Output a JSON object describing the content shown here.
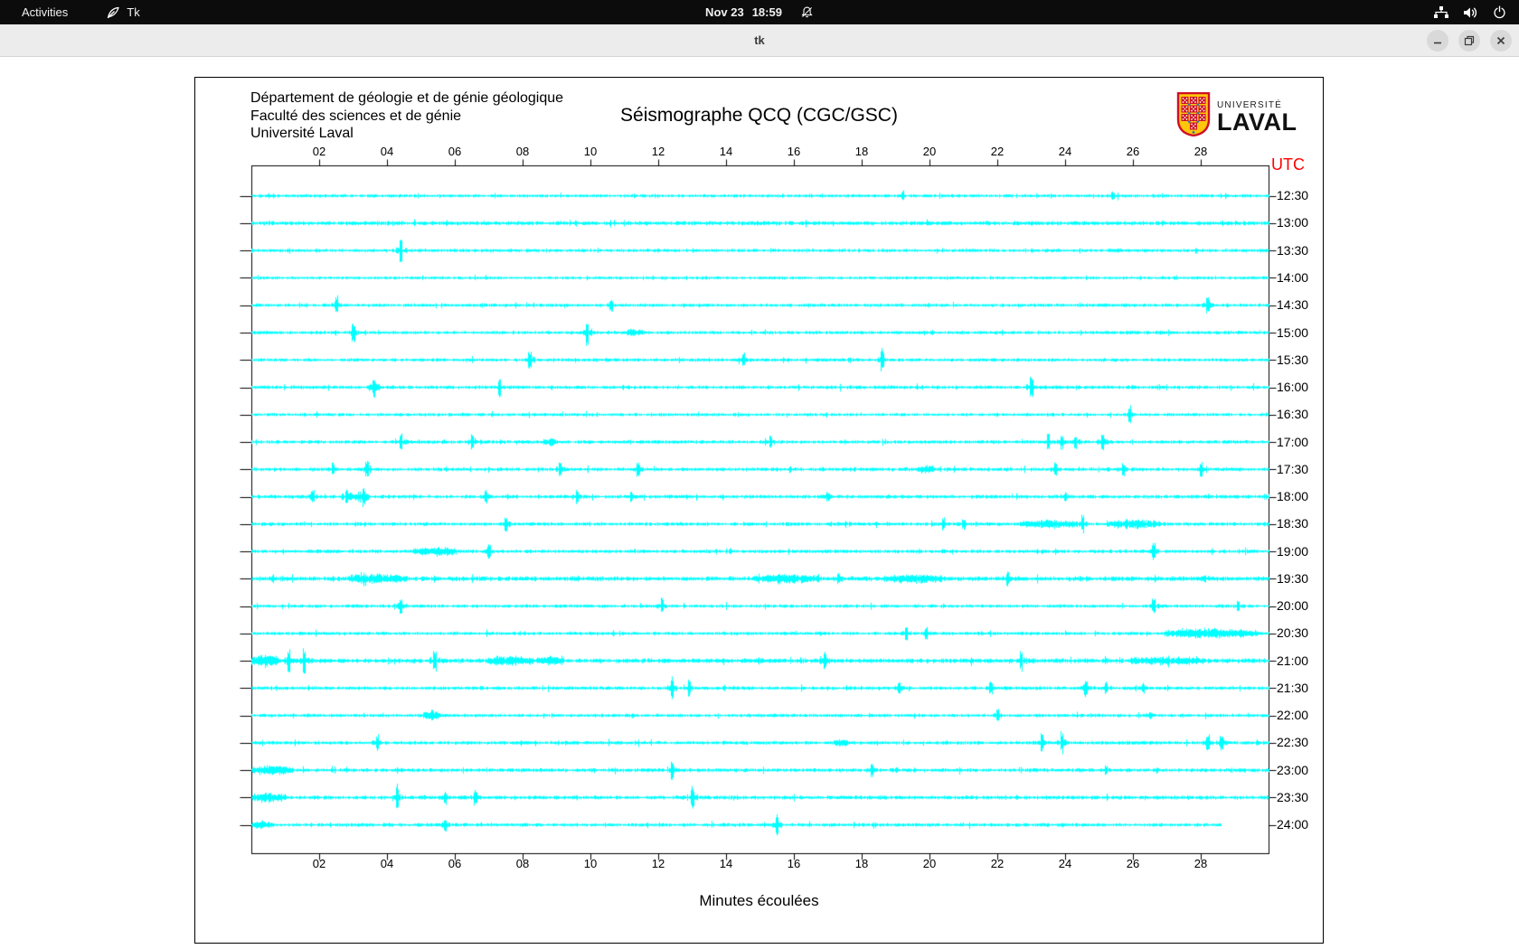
{
  "topbar": {
    "activities_label": "Activities",
    "app_indicator": "Tk",
    "clock_date": "Nov 23",
    "clock_time": "18:59"
  },
  "titlebar": {
    "title": "tk"
  },
  "header": {
    "line1": "Département de géologie et de génie géologique",
    "line2": "Faculté des sciences et de génie",
    "line3": "Université Laval"
  },
  "logo": {
    "line1": "UNIVERSITÉ",
    "line2": "LAVAL"
  },
  "chart_data": {
    "type": "line",
    "title": "Séismographe QCQ (CGC/GSC)",
    "xlabel": "Minutes écoulées",
    "right_axis_label": "UTC",
    "right_axis_color": "#ff0000",
    "trace_color": "#00ffff",
    "x_range_minutes": [
      0,
      30
    ],
    "x_tick_interval_minutes": 2,
    "x_ticks": [
      "02",
      "04",
      "06",
      "08",
      "10",
      "12",
      "14",
      "16",
      "18",
      "20",
      "22",
      "24",
      "26",
      "28"
    ],
    "row_interval": "30 min per line, UTC times on right axis",
    "grid": false,
    "rows": [
      {
        "label": "12:30",
        "noise": 1.6,
        "events": [
          {
            "t": "s",
            "m": 19.2,
            "a": 5
          },
          {
            "t": "s",
            "m": 25.4,
            "a": 4
          }
        ]
      },
      {
        "label": "13:00",
        "noise": 2.0,
        "events": []
      },
      {
        "label": "13:30",
        "noise": 1.6,
        "events": [
          {
            "t": "s",
            "m": 4.4,
            "a": 16
          }
        ]
      },
      {
        "label": "14:00",
        "noise": 1.4,
        "events": []
      },
      {
        "label": "14:30",
        "noise": 1.6,
        "events": [
          {
            "t": "s",
            "m": 2.5,
            "a": 11
          },
          {
            "t": "s",
            "m": 10.6,
            "a": 6
          },
          {
            "t": "s",
            "m": 28.2,
            "a": 10
          }
        ]
      },
      {
        "label": "15:00",
        "noise": 1.6,
        "events": [
          {
            "t": "s",
            "m": 3.0,
            "a": 10
          },
          {
            "t": "s",
            "m": 9.9,
            "a": 13
          },
          {
            "t": "b",
            "m": 11.3,
            "w": 0.5,
            "a": 4
          }
        ]
      },
      {
        "label": "15:30",
        "noise": 1.6,
        "events": [
          {
            "t": "s",
            "m": 8.2,
            "a": 11
          },
          {
            "t": "s",
            "m": 14.5,
            "a": 7
          },
          {
            "t": "s",
            "m": 18.6,
            "a": 12
          }
        ]
      },
      {
        "label": "16:00",
        "noise": 1.7,
        "events": [
          {
            "t": "b",
            "m": 3.6,
            "w": 0.4,
            "a": 4
          },
          {
            "t": "s",
            "m": 3.6,
            "a": 7
          },
          {
            "t": "s",
            "m": 7.3,
            "a": 9
          },
          {
            "t": "s",
            "m": 23.0,
            "a": 11
          }
        ]
      },
      {
        "label": "16:30",
        "noise": 1.5,
        "events": [
          {
            "t": "s",
            "m": 25.9,
            "a": 10
          }
        ]
      },
      {
        "label": "17:00",
        "noise": 1.7,
        "events": [
          {
            "t": "s",
            "m": 4.4,
            "a": 7
          },
          {
            "t": "s",
            "m": 6.5,
            "a": 7
          },
          {
            "t": "b",
            "m": 8.8,
            "w": 0.4,
            "a": 4
          },
          {
            "t": "s",
            "m": 15.3,
            "a": 7
          },
          {
            "t": "s",
            "m": 23.5,
            "a": 9
          },
          {
            "t": "s",
            "m": 23.9,
            "a": 8
          },
          {
            "t": "s",
            "m": 24.3,
            "a": 7
          },
          {
            "t": "s",
            "m": 25.1,
            "a": 10
          }
        ]
      },
      {
        "label": "17:30",
        "noise": 1.7,
        "events": [
          {
            "t": "s",
            "m": 2.4,
            "a": 7
          },
          {
            "t": "s",
            "m": 3.4,
            "a": 8
          },
          {
            "t": "s",
            "m": 9.1,
            "a": 9
          },
          {
            "t": "s",
            "m": 11.4,
            "a": 7
          },
          {
            "t": "b",
            "m": 19.9,
            "w": 0.5,
            "a": 4
          },
          {
            "t": "s",
            "m": 23.7,
            "a": 6
          },
          {
            "t": "s",
            "m": 25.7,
            "a": 8
          },
          {
            "t": "s",
            "m": 28.0,
            "a": 7
          }
        ]
      },
      {
        "label": "18:00",
        "noise": 1.8,
        "events": [
          {
            "t": "s",
            "m": 1.8,
            "a": 6
          },
          {
            "t": "s",
            "m": 2.8,
            "a": 8
          },
          {
            "t": "b",
            "m": 3.1,
            "w": 0.6,
            "a": 3
          },
          {
            "t": "s",
            "m": 3.3,
            "a": 8
          },
          {
            "t": "s",
            "m": 6.9,
            "a": 7
          },
          {
            "t": "s",
            "m": 9.6,
            "a": 8
          },
          {
            "t": "s",
            "m": 11.2,
            "a": 6
          },
          {
            "t": "s",
            "m": 17.0,
            "a": 5
          },
          {
            "t": "s",
            "m": 24.0,
            "a": 4
          }
        ]
      },
      {
        "label": "18:30",
        "noise": 1.7,
        "events": [
          {
            "t": "s",
            "m": 7.5,
            "a": 8
          },
          {
            "t": "s",
            "m": 20.4,
            "a": 7
          },
          {
            "t": "s",
            "m": 21.0,
            "a": 6
          },
          {
            "t": "b",
            "m": 23.5,
            "w": 1.7,
            "a": 4.5
          },
          {
            "t": "s",
            "m": 24.5,
            "a": 9
          },
          {
            "t": "b",
            "m": 26.0,
            "w": 1.6,
            "a": 4.5
          }
        ]
      },
      {
        "label": "19:00",
        "noise": 1.7,
        "events": [
          {
            "t": "b",
            "m": 5.4,
            "w": 1.3,
            "a": 4.5
          },
          {
            "t": "s",
            "m": 7.0,
            "a": 8
          },
          {
            "t": "s",
            "m": 26.6,
            "a": 8
          }
        ]
      },
      {
        "label": "19:30",
        "noise": 2.2,
        "events": [
          {
            "t": "b",
            "m": 3.7,
            "w": 1.8,
            "a": 4.5
          },
          {
            "t": "b",
            "m": 15.8,
            "w": 2.0,
            "a": 4
          },
          {
            "t": "s",
            "m": 17.3,
            "a": 5
          },
          {
            "t": "b",
            "m": 19.5,
            "w": 1.7,
            "a": 4
          },
          {
            "t": "s",
            "m": 22.3,
            "a": 7
          },
          {
            "t": "s",
            "m": 28.1,
            "a": 3
          }
        ]
      },
      {
        "label": "20:00",
        "noise": 1.6,
        "events": [
          {
            "t": "s",
            "m": 4.4,
            "a": 10
          },
          {
            "t": "s",
            "m": 12.1,
            "a": 9
          },
          {
            "t": "s",
            "m": 26.6,
            "a": 7
          },
          {
            "t": "s",
            "m": 29.1,
            "a": 6
          }
        ]
      },
      {
        "label": "20:30",
        "noise": 1.6,
        "events": [
          {
            "t": "s",
            "m": 19.3,
            "a": 8
          },
          {
            "t": "s",
            "m": 19.9,
            "a": 6
          },
          {
            "t": "b",
            "m": 28.3,
            "w": 2.8,
            "a": 5.5
          }
        ]
      },
      {
        "label": "21:00",
        "noise": 2.2,
        "events": [
          {
            "t": "b",
            "m": 0.4,
            "w": 0.9,
            "a": 6
          },
          {
            "t": "s",
            "m": 1.1,
            "a": 13
          },
          {
            "t": "s",
            "m": 1.55,
            "a": 15
          },
          {
            "t": "s",
            "m": 5.4,
            "a": 9
          },
          {
            "t": "b",
            "m": 7.6,
            "w": 1.4,
            "a": 4.5
          },
          {
            "t": "b",
            "m": 8.8,
            "w": 0.8,
            "a": 4.5
          },
          {
            "t": "s",
            "m": 16.9,
            "a": 11
          },
          {
            "t": "s",
            "m": 22.7,
            "a": 12
          },
          {
            "t": "b",
            "m": 27.0,
            "w": 2.2,
            "a": 3.5
          }
        ]
      },
      {
        "label": "21:30",
        "noise": 1.7,
        "events": [
          {
            "t": "s",
            "m": 12.4,
            "a": 12
          },
          {
            "t": "s",
            "m": 12.9,
            "a": 9
          },
          {
            "t": "s",
            "m": 19.1,
            "a": 6
          },
          {
            "t": "s",
            "m": 21.8,
            "a": 7
          },
          {
            "t": "s",
            "m": 24.6,
            "a": 8
          },
          {
            "t": "s",
            "m": 25.2,
            "a": 7
          },
          {
            "t": "s",
            "m": 26.3,
            "a": 6
          }
        ]
      },
      {
        "label": "22:00",
        "noise": 1.6,
        "events": [
          {
            "t": "b",
            "m": 5.3,
            "w": 0.5,
            "a": 5
          },
          {
            "t": "s",
            "m": 22.0,
            "a": 8
          },
          {
            "t": "s",
            "m": 26.5,
            "a": 4
          }
        ]
      },
      {
        "label": "22:30",
        "noise": 1.7,
        "events": [
          {
            "t": "s",
            "m": 3.7,
            "a": 8
          },
          {
            "t": "b",
            "m": 17.4,
            "w": 0.5,
            "a": 4
          },
          {
            "t": "s",
            "m": 23.3,
            "a": 10
          },
          {
            "t": "s",
            "m": 23.9,
            "a": 11
          },
          {
            "t": "s",
            "m": 28.2,
            "a": 9
          },
          {
            "t": "s",
            "m": 28.6,
            "a": 8
          }
        ]
      },
      {
        "label": "23:00",
        "noise": 1.8,
        "events": [
          {
            "t": "b",
            "m": 0.6,
            "w": 1.3,
            "a": 5
          },
          {
            "t": "s",
            "m": 12.4,
            "a": 11
          },
          {
            "t": "s",
            "m": 18.3,
            "a": 8
          },
          {
            "t": "s",
            "m": 25.2,
            "a": 5
          }
        ]
      },
      {
        "label": "23:30",
        "noise": 1.8,
        "events": [
          {
            "t": "b",
            "m": 0.5,
            "w": 1.0,
            "a": 5
          },
          {
            "t": "s",
            "m": 4.3,
            "a": 12
          },
          {
            "t": "s",
            "m": 5.7,
            "a": 7
          },
          {
            "t": "s",
            "m": 6.6,
            "a": 8
          },
          {
            "t": "s",
            "m": 13.0,
            "a": 11
          }
        ]
      },
      {
        "label": "24:00",
        "noise": 1.7,
        "end": 28.6,
        "events": [
          {
            "t": "b",
            "m": 0.3,
            "w": 0.6,
            "a": 4
          },
          {
            "t": "s",
            "m": 5.7,
            "a": 9
          },
          {
            "t": "s",
            "m": 15.5,
            "a": 11
          }
        ]
      }
    ]
  }
}
